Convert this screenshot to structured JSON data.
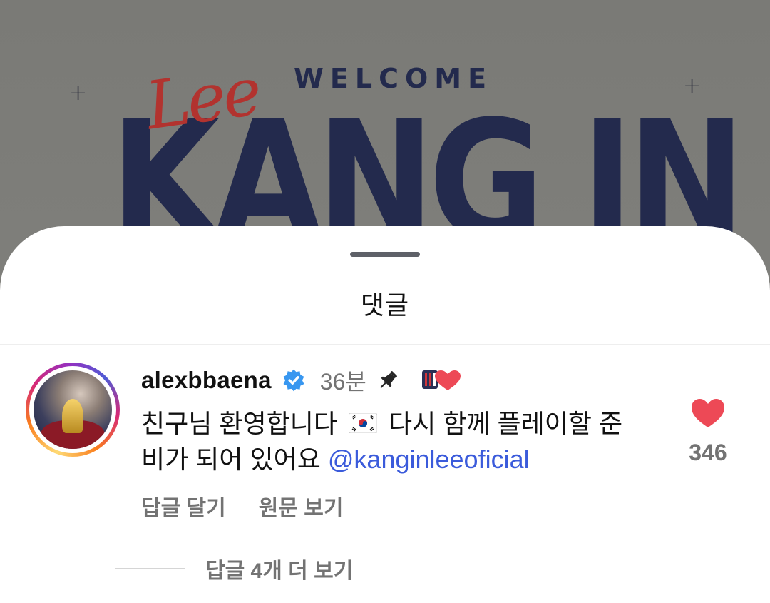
{
  "post": {
    "welcome_text": "WELCOME",
    "script_name": "Lee",
    "big_name": "KANG IN"
  },
  "sheet": {
    "title": "댓글"
  },
  "comment": {
    "username": "alexbbaena",
    "time": "36분",
    "text_part1": "친구님 환영합니다",
    "text_part2": "다시 함께 플레이할 준비가 되어 있어요",
    "mention": "@kanginleeoficial",
    "like_count": "346",
    "reply_label": "답글 달기",
    "see_original_label": "원문 보기",
    "icons": {
      "verified": "verified-badge-icon",
      "pin": "pin-icon",
      "creator_heart": "creator-liked-heart-icon",
      "like": "heart-icon",
      "flag": "south-korea-flag-icon"
    }
  },
  "more_replies": {
    "label": "답글 4개 더 보기"
  },
  "colors": {
    "mention": "#3b5bdb",
    "like_heart": "#ed4956",
    "verified": "#3897f0",
    "navy": "#232a4d",
    "script_red": "#b2332f"
  }
}
